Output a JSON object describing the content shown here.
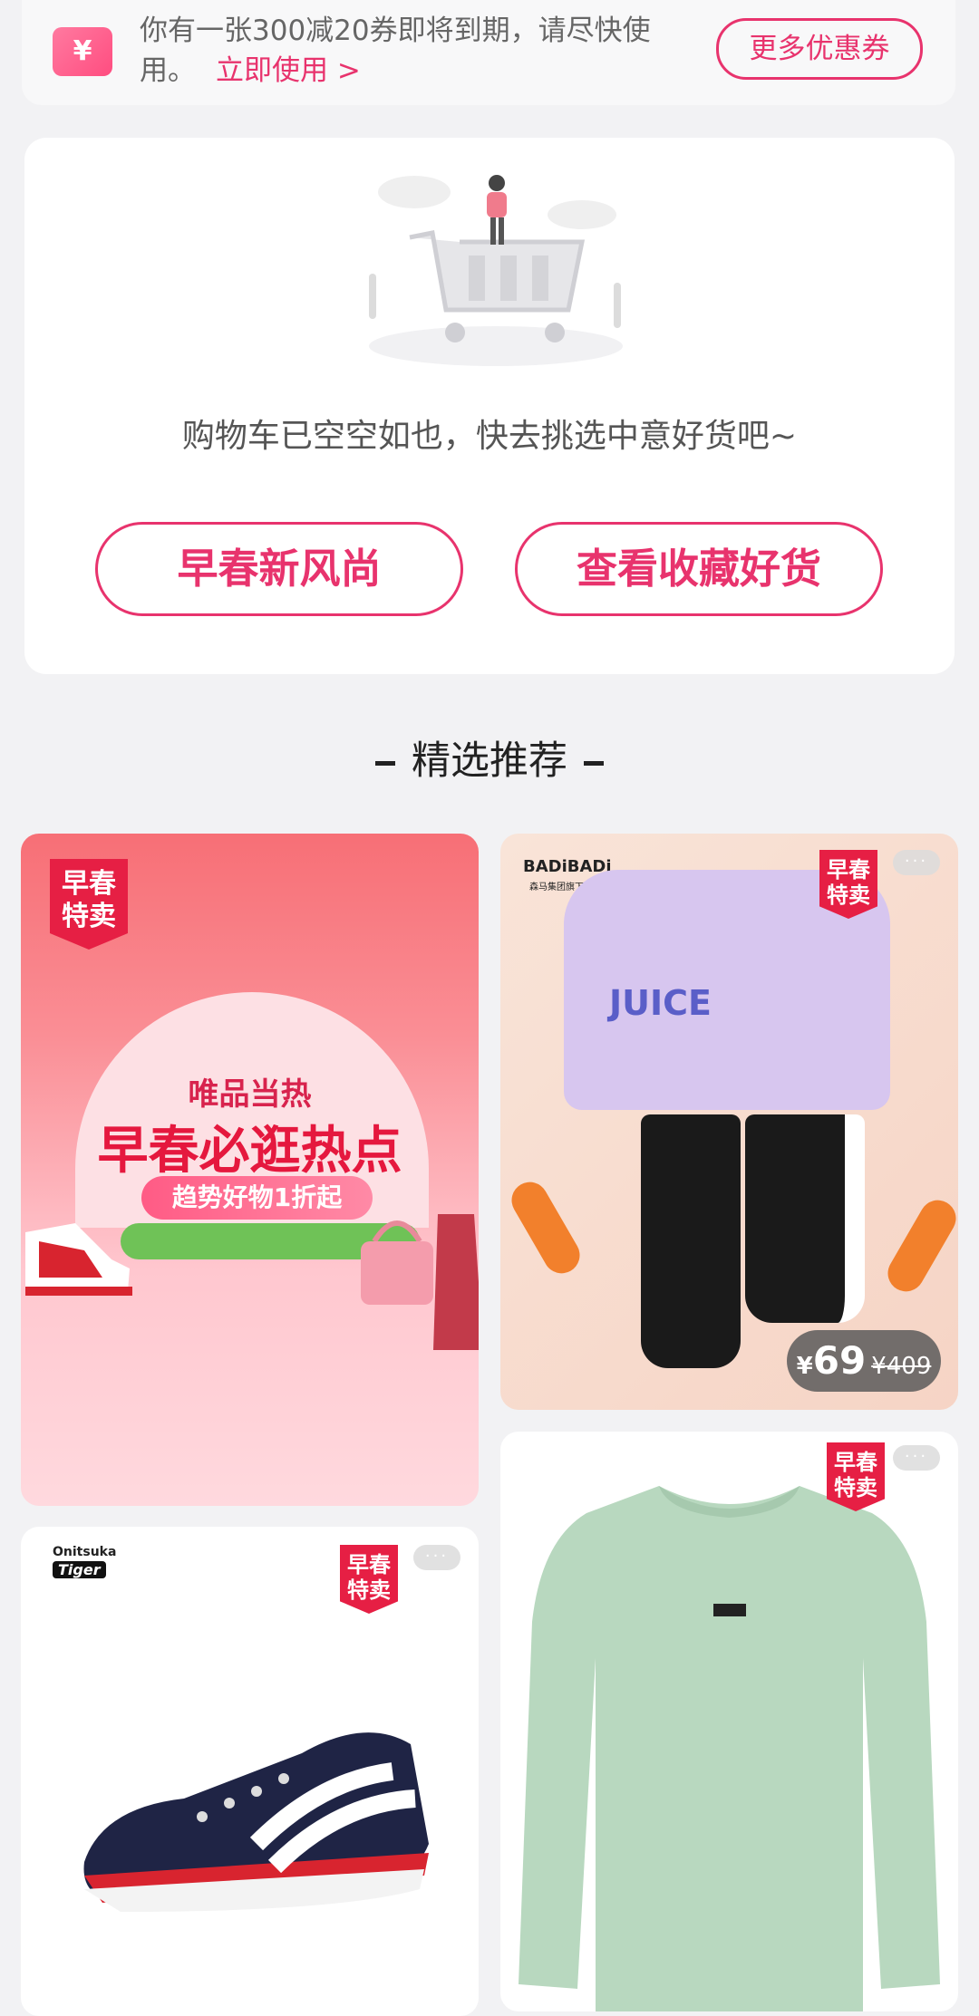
{
  "coupon": {
    "icon": "yen-coupon-icon",
    "text": "你有一张300减20券即将到期，请尽快使用。",
    "link": "立即使用 >",
    "more_button": "更多优惠券"
  },
  "empty_cart": {
    "message": "购物车已空空如也，快去挑选中意好货吧~",
    "btn_spring": "早春新风尚",
    "btn_favorites": "查看收藏好货"
  },
  "section": {
    "title": "精选推荐"
  },
  "products": {
    "promo": {
      "badge_line1": "早春",
      "badge_line2": "特卖",
      "subtitle": "唯品当热",
      "title": "早春必逛热点",
      "pill": "趋势好物1折起"
    },
    "kids_set": {
      "brand": "BADiBADi",
      "brand_sub": "森马集团旗下",
      "print": "JUICE",
      "badge_line1": "早春",
      "badge_line2": "特卖",
      "price_currency": "¥",
      "price": "69",
      "original_price": "¥409",
      "menu": "···"
    },
    "shoe": {
      "brand": "Onitsuka",
      "brand_sub": "Tiger",
      "badge_line1": "早春",
      "badge_line2": "特卖",
      "menu": "···"
    },
    "shirt": {
      "badge_line1": "早春",
      "badge_line2": "特卖",
      "menu": "···"
    }
  },
  "colors": {
    "accent": "#e8336d",
    "badge": "#e61f44",
    "background": "#f2f2f4"
  }
}
